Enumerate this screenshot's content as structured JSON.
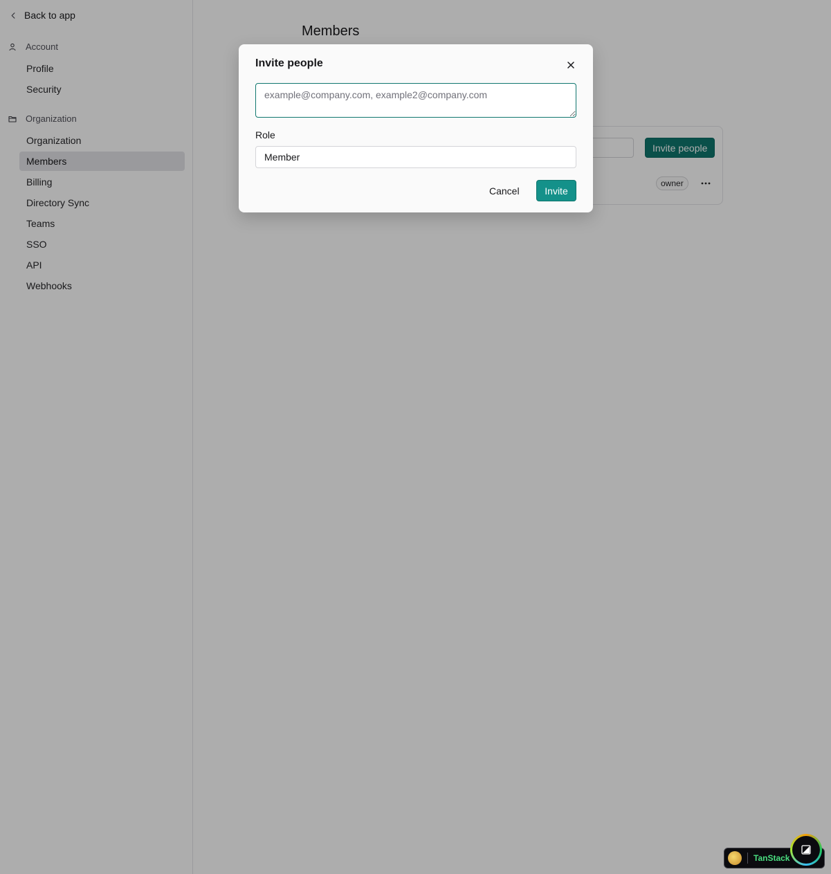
{
  "sidebar": {
    "back_label": "Back to app",
    "account_section": "Account",
    "account_items": [
      "Profile",
      "Security"
    ],
    "org_section": "Organization",
    "org_items": [
      "Organization",
      "Members",
      "Billing",
      "Directory Sync",
      "Teams",
      "SSO",
      "API",
      "Webhooks"
    ],
    "active_item": "Members"
  },
  "main": {
    "title": "Members",
    "invite_button_label": "Invite people",
    "member_role_badge": "owner"
  },
  "dialog": {
    "title": "Invite people",
    "emails_value": "",
    "emails_placeholder": "example@company.com, example2@company.com",
    "role_label": "Role",
    "role_value": "Member",
    "cancel_label": "Cancel",
    "invite_label": "Invite"
  },
  "devtools": {
    "label": "TanStack"
  },
  "colors": {
    "accent": "#0f766e",
    "accent_button": "#14918a",
    "overlay": "rgba(0,0,0,0.32)"
  }
}
